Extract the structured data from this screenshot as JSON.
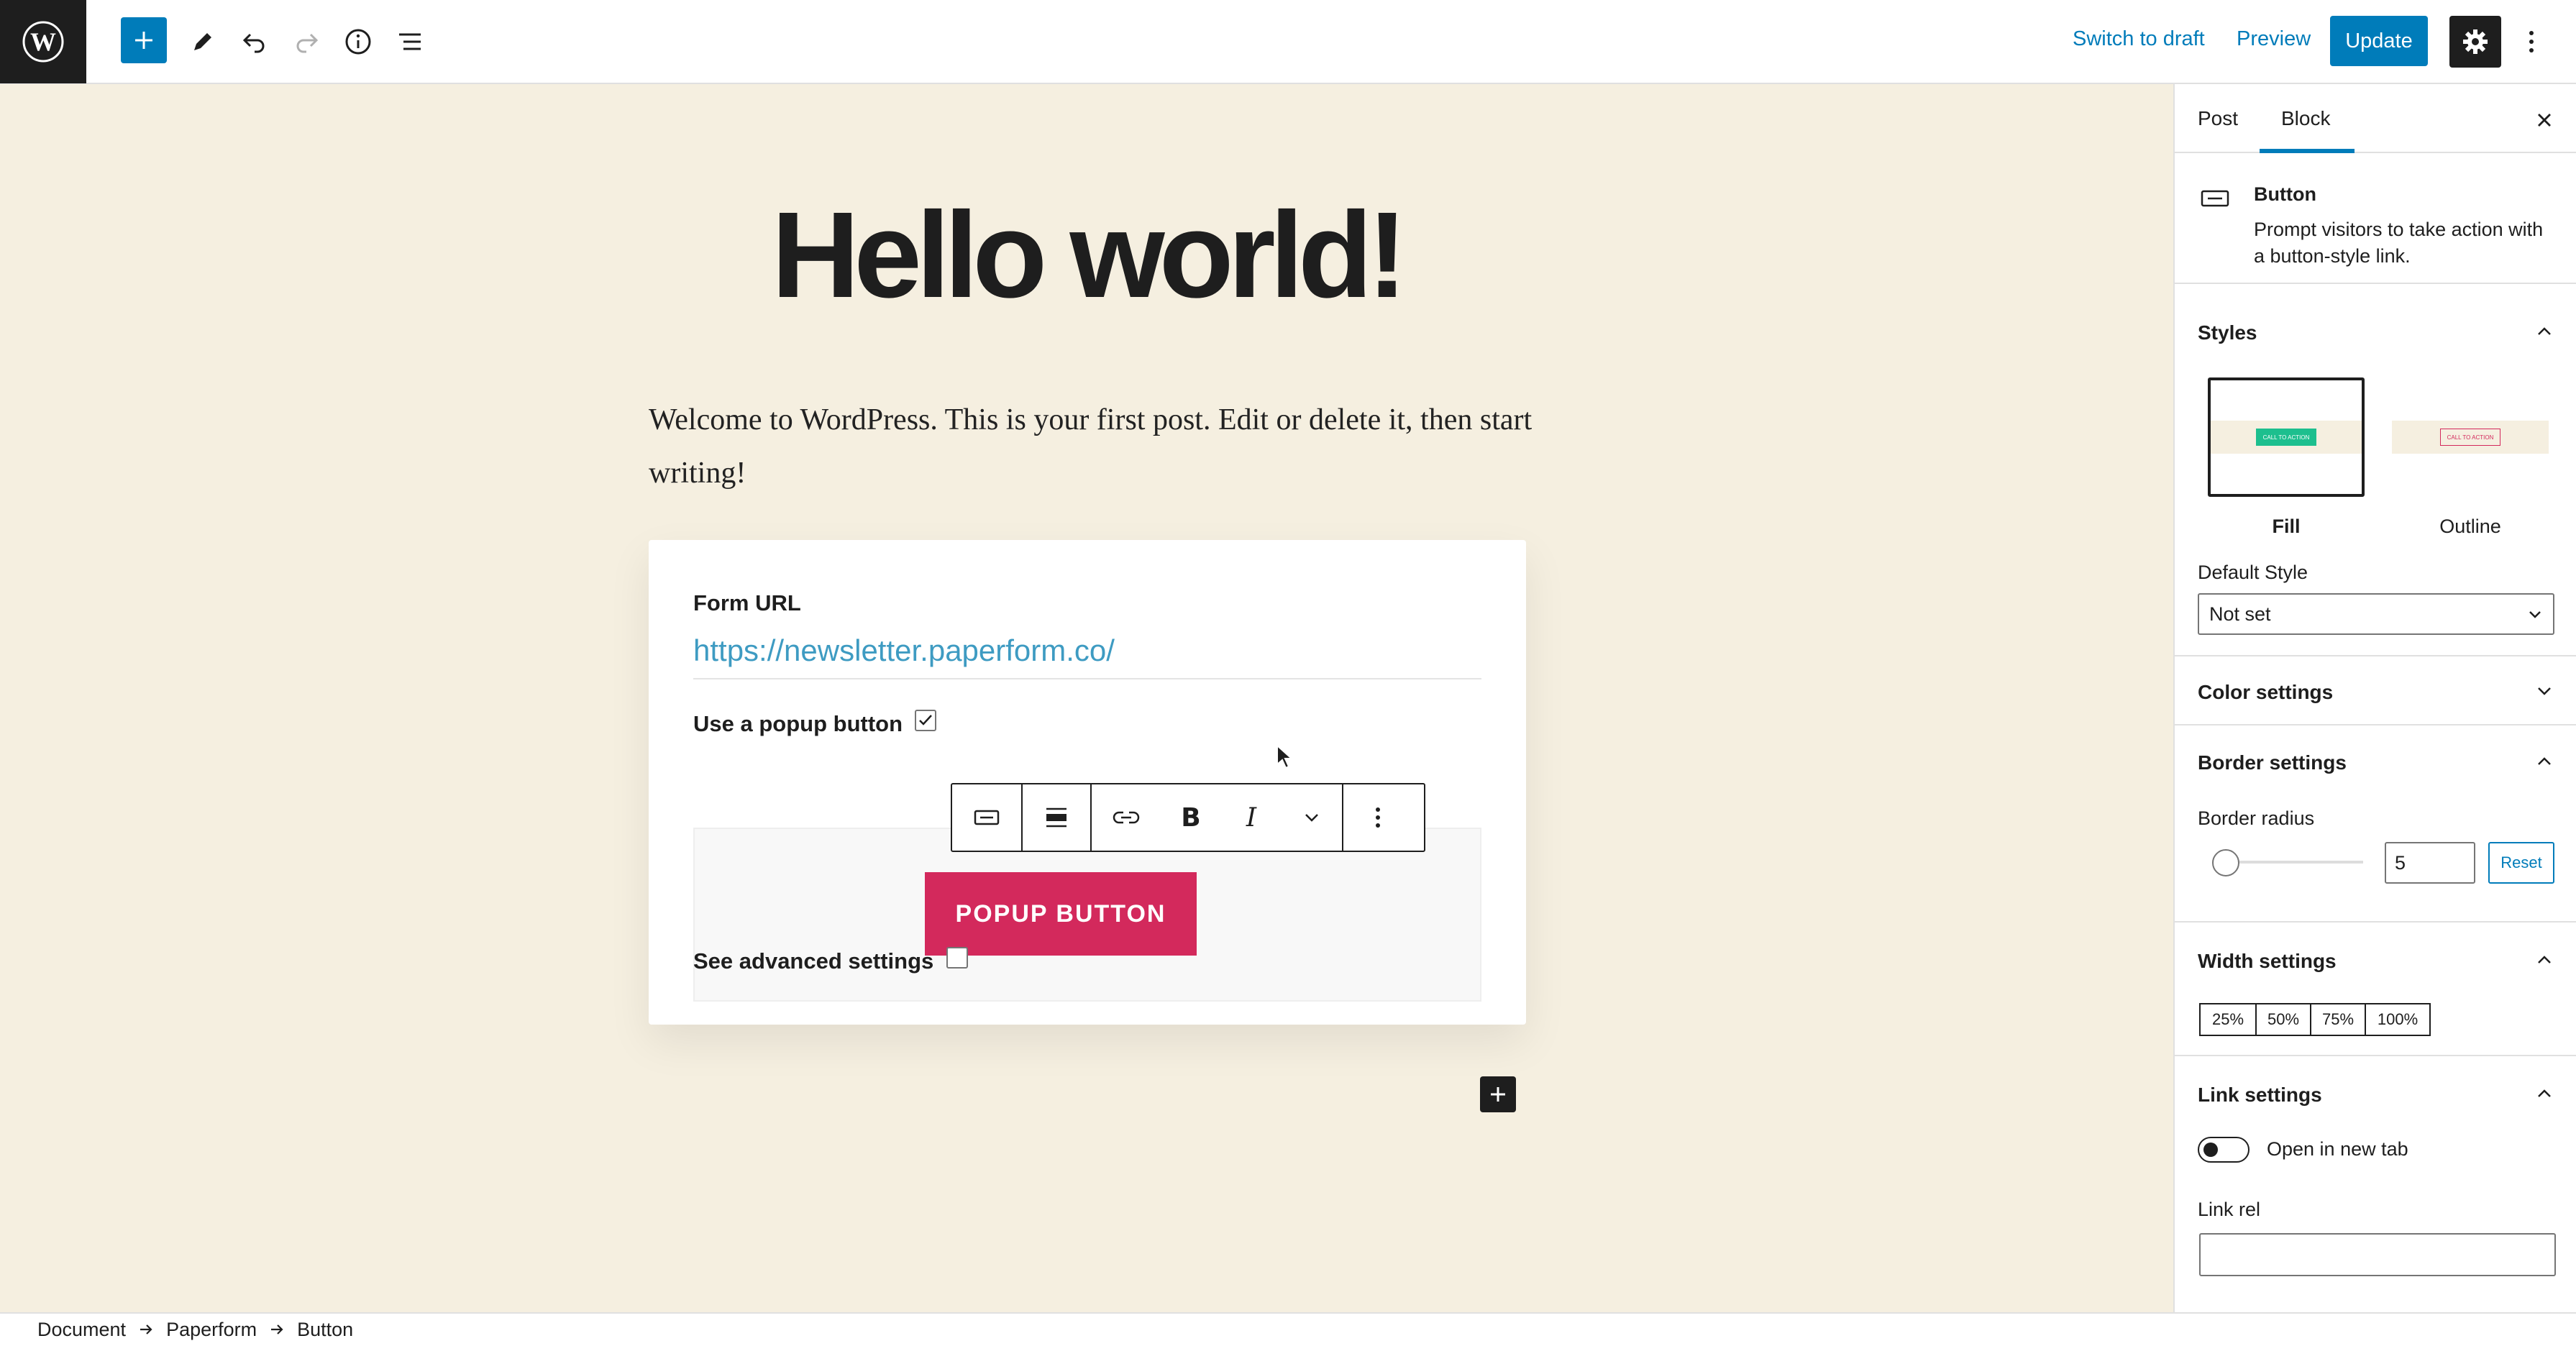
{
  "topbar": {
    "switch_to_draft": "Switch to draft",
    "preview": "Preview",
    "update": "Update",
    "icons": [
      "wordpress-logo-icon",
      "plus-icon",
      "pencil-icon",
      "undo-icon",
      "redo-icon",
      "info-icon",
      "list-view-icon",
      "gear-icon",
      "more-vertical-icon"
    ]
  },
  "post": {
    "title": "Hello world!",
    "paragraph": "Welcome to WordPress. This is your first post. Edit or delete it, then start writing!"
  },
  "form_block": {
    "url_label": "Form URL",
    "url_value": "https://newsletter.paperform.co/",
    "popup_label": "Use a popup button",
    "popup_checked": true,
    "popup_button": "POPUP BUTTON",
    "advanced_label": "See advanced settings",
    "advanced_checked": false,
    "popup_color": "#d3295c"
  },
  "block_toolbar": {
    "bold": "B",
    "italic": "I",
    "icons": [
      "button-block-icon",
      "align-icon",
      "link-icon",
      "bold-icon",
      "italic-icon",
      "chevron-down-icon",
      "more-vertical-icon"
    ]
  },
  "sidebar": {
    "tabs": [
      "Post",
      "Block"
    ],
    "active_tab": "Block",
    "block_name": "Button",
    "block_desc_1": "Prompt visitors to take action with",
    "block_desc_2": "a button-style link.",
    "styles": {
      "heading": "Styles",
      "fill_label": "Fill",
      "outline_label": "Outline",
      "thumb_text": "CALL TO ACTION",
      "selected": "Fill",
      "default_style_label": "Default Style",
      "default_style_value": "Not set"
    },
    "color_settings": "Color settings",
    "border": {
      "heading": "Border settings",
      "radius_label": "Border radius",
      "radius_value": "5",
      "reset": "Reset"
    },
    "width": {
      "heading": "Width settings",
      "options": [
        "25%",
        "50%",
        "75%",
        "100%"
      ]
    },
    "link": {
      "heading": "Link settings",
      "new_tab_label": "Open in new tab",
      "new_tab_on": false,
      "rel_label": "Link rel",
      "rel_value": ""
    }
  },
  "breadcrumb": [
    "Document",
    "Paperform",
    "Button"
  ],
  "colors": {
    "accent": "#007cba",
    "canvas_bg": "#f5efe0",
    "dark": "#1e1e1e",
    "thumb_fill": "#1dbf8e",
    "thumb_outline": "#d3295c"
  }
}
